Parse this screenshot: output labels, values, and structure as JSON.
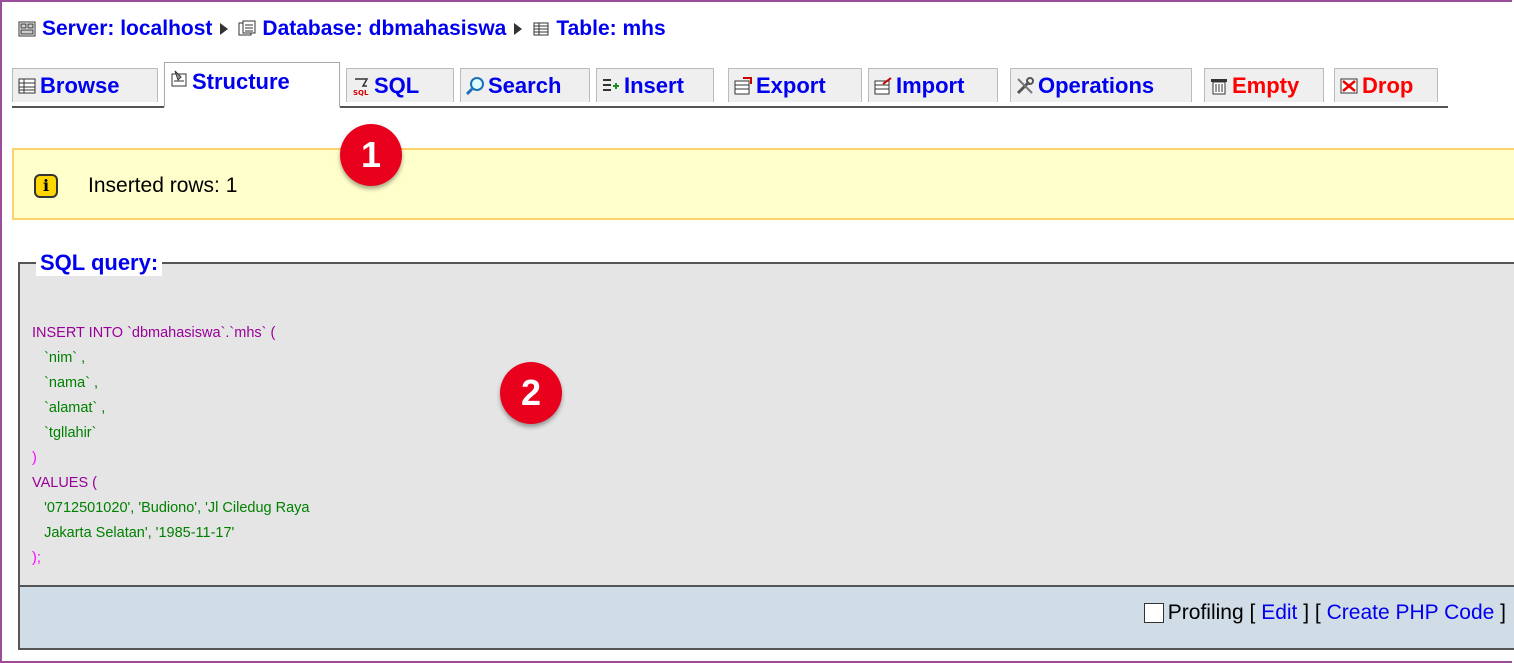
{
  "breadcrumb": {
    "server": "Server: localhost",
    "database": "Database: dbmahasiswa",
    "table": "Table: mhs"
  },
  "tabs": [
    {
      "label": "Browse",
      "icon": "browse-icon"
    },
    {
      "label": "Structure",
      "icon": "structure-icon",
      "active": true
    },
    {
      "label": "SQL",
      "icon": "sql-icon"
    },
    {
      "label": "Search",
      "icon": "search-icon"
    },
    {
      "label": "Insert",
      "icon": "insert-icon"
    },
    {
      "label": "Export",
      "icon": "export-icon"
    },
    {
      "label": "Import",
      "icon": "import-icon"
    },
    {
      "label": "Operations",
      "icon": "operations-icon"
    },
    {
      "label": "Empty",
      "icon": "empty-icon",
      "color": "#ff0000"
    },
    {
      "label": "Drop",
      "icon": "drop-icon",
      "color": "#ff0000"
    }
  ],
  "notice": {
    "text": "Inserted rows: 1",
    "icon": "info-icon"
  },
  "badges": {
    "one": "1",
    "two": "2",
    "color": "#e8001c"
  },
  "sql": {
    "legend": "SQL query:",
    "lines": {
      "l1": "INSERT INTO `dbmahasiswa`.`mhs` (",
      "l2": "`nim` ,",
      "l3": "`nama` ,",
      "l4": "`alamat` ,",
      "l5": "`tgllahir`",
      "l6": ")",
      "l7": "VALUES (",
      "l8": "'0712501020', 'Budiono', 'Jl Ciledug Raya",
      "l9": "Jakarta Selatan', '1985-11-17'",
      "l10": ");"
    }
  },
  "footer": {
    "profiling": "Profiling",
    "edit": "Edit",
    "create_php": "Create PHP Code",
    "bracket_open": "[",
    "bracket_close": "]"
  },
  "colors": {
    "link": "#0000ee",
    "notice_bg": "#ffffcc",
    "sql_bg": "#e5e5e5",
    "footer_bg": "#d0dce6",
    "frame": "#9b4c9b"
  }
}
